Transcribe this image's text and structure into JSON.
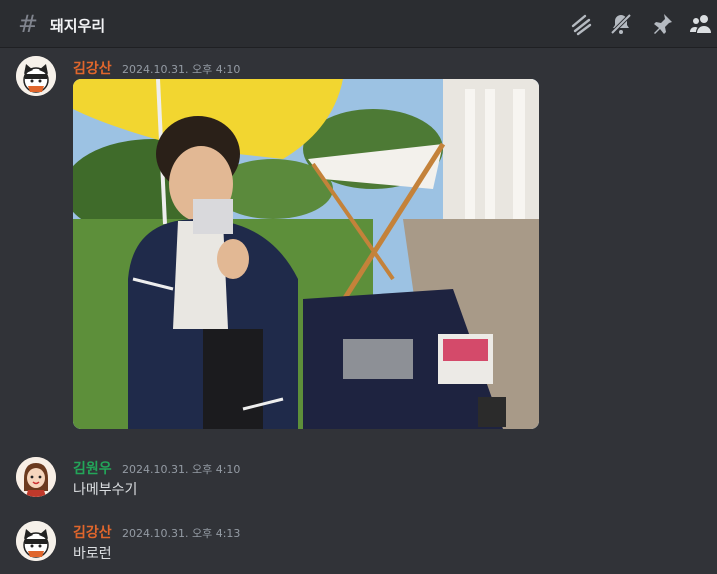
{
  "channel": {
    "name": "돼지우리",
    "hash_icon": "hash-icon"
  },
  "header_icons": [
    "threads-icon",
    "mute-notifications-icon",
    "pin-icon",
    "members-icon"
  ],
  "messages": [
    {
      "author": "김강산",
      "author_color": "#e0662c",
      "timestamp": "2024.10.31. 오후 4:10",
      "text": "",
      "attachment": "image"
    },
    {
      "author": "김원우",
      "author_color": "#23a559",
      "timestamp": "2024.10.31. 오후 4:10",
      "text": "나메부수기"
    },
    {
      "author": "김강산",
      "author_color": "#e0662c",
      "timestamp": "2024.10.31. 오후 4:13",
      "text": "바로런"
    }
  ]
}
